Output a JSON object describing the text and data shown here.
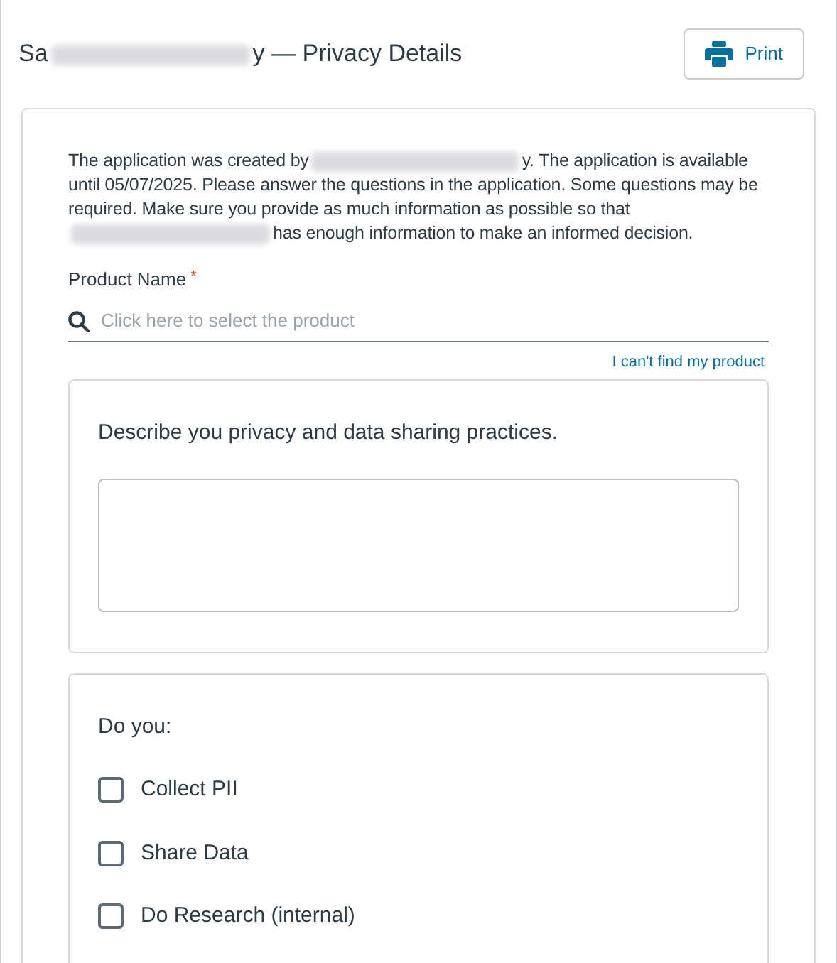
{
  "header": {
    "title": [
      {
        "kind": "text",
        "text": "Sa"
      },
      {
        "kind": "redacted"
      },
      {
        "kind": "text",
        "text": "y — Privacy Details"
      }
    ],
    "print_button": "Print"
  },
  "intro": [
    {
      "kind": "text",
      "text": "The application was created by"
    },
    {
      "kind": "redacted"
    },
    {
      "kind": "text",
      "text": "y. The application is available until 05/07/2025. Please answer the questions in the application. Some questions may be required. Make sure you provide as much information as possible so that"
    },
    {
      "kind": "redacted"
    },
    {
      "kind": "text",
      "text": "has enough information to make an informed decision."
    }
  ],
  "product": {
    "label": "Product Name",
    "required_mark": "*",
    "placeholder": "Click here to select the product",
    "link": "I can't find my product"
  },
  "practices": {
    "question": "Describe you privacy and data sharing practices."
  },
  "checklist": {
    "question": "Do you:",
    "options": [
      {
        "label": "Collect PII",
        "checked": false
      },
      {
        "label": "Share Data",
        "checked": false
      },
      {
        "label": "Do Research (internal)",
        "checked": false
      }
    ]
  }
}
